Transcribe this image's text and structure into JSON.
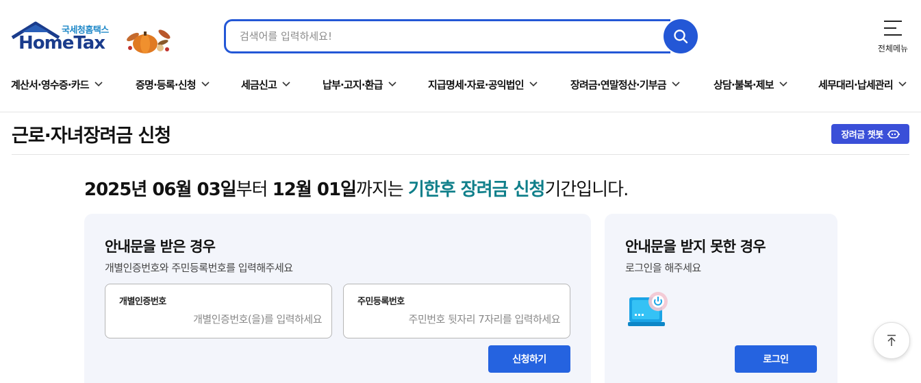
{
  "header": {
    "logo": {
      "brand_kor": "국세청홈택스",
      "brand_en": "HomeTax",
      "decoration_icon": "pumpkin-icon"
    },
    "search": {
      "placeholder": "검색어를 입력하세요!",
      "value": "",
      "button_icon": "search-icon"
    },
    "all_menu": {
      "label": "전체메뉴",
      "icon": "hamburger-icon"
    }
  },
  "gnb": {
    "items": [
      {
        "label": "계산서·영수증·카드"
      },
      {
        "label": "증명·등록·신청"
      },
      {
        "label": "세금신고"
      },
      {
        "label": "납부·고지·환급"
      },
      {
        "label": "지급명세·자료·공익법인"
      },
      {
        "label": "장려금·연말정산·기부금"
      },
      {
        "label": "상담·불복·제보"
      },
      {
        "label": "세무대리·납세관리"
      }
    ]
  },
  "page": {
    "title": "근로·자녀장려금 신청",
    "chatbot_label": "장려금 챗봇"
  },
  "period": {
    "start": "2025년 06월 03일",
    "from": "부터 ",
    "end": "12월 01일",
    "until": "까지는 ",
    "highlight": "기한후 장려금 신청",
    "suffix": "기간입니다."
  },
  "card_notice": {
    "title": "안내문을 받은 경우",
    "desc": "개별인증번호와 주민등록번호를 입력해주세요",
    "auth_field": {
      "label": "개별인증번호",
      "placeholder": "개별인증번호(을)를 입력하세요"
    },
    "rrn_field": {
      "label": "주민등록번호",
      "placeholder": "주민번호 뒷자리 7자리를 입력하세요"
    },
    "submit_label": "신청하기"
  },
  "card_no_notice": {
    "title": "안내문을 받지 못한 경우",
    "desc": "로그인을 해주세요",
    "icon": "laptop-power-icon",
    "login_label": "로그인"
  },
  "scroll_top_icon": "arrow-up-icon",
  "colors": {
    "primary": "#2357d6",
    "button": "#2563e0",
    "highlight": "#0f7f8a",
    "chatbot": "#3a4fd8",
    "card_bg": "#f3f5fb"
  }
}
